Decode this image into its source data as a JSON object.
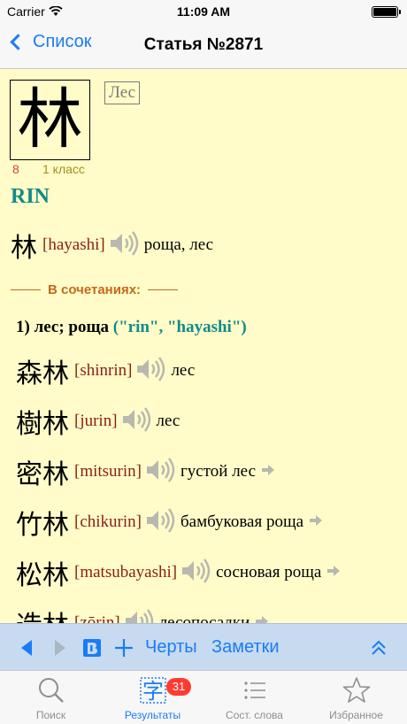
{
  "status_bar": {
    "carrier": "Carrier",
    "time": "11:09 AM"
  },
  "nav": {
    "back_label": "Список",
    "title": "Статья №2871"
  },
  "kanji": {
    "character": "林",
    "meaning": "Лес",
    "strokes": "8",
    "grade": "1 класс",
    "on_reading": "RIN"
  },
  "main_entry": {
    "jp": "林",
    "romaji": "[hayashi]",
    "translation": "роща, лес"
  },
  "combinations": {
    "header": "В сочетаниях:",
    "sense": "1) лес; роща",
    "sense_readings": "(\"rin\", \"hayashi\")",
    "items": [
      {
        "jp": "森林",
        "romaji": "[shinrin]",
        "translation": "лес"
      },
      {
        "jp": "樹林",
        "romaji": "[jurin]",
        "translation": "лес"
      },
      {
        "jp": "密林",
        "romaji": "[mitsurin]",
        "translation": "густой лес"
      },
      {
        "jp": "竹林",
        "romaji": "[chikurin]",
        "translation": "бамбуковая роща"
      },
      {
        "jp": "松林",
        "romaji": "[matsubayashi]",
        "translation": "сосновая роща"
      },
      {
        "jp": "造林",
        "romaji": "[zōrin]",
        "translation": "лесопосадки"
      }
    ]
  },
  "toolbar": {
    "strokes_label": "Черты",
    "notes_label": "Заметки"
  },
  "tabs": [
    {
      "label": "Поиск"
    },
    {
      "label": "Результаты",
      "badge": "31",
      "icon_char": "字"
    },
    {
      "label": "Сост. слова"
    },
    {
      "label": "Избранное"
    }
  ],
  "colors": {
    "accent": "#1a7cf5",
    "background": "#fffcc9",
    "reading": "#138a8a",
    "romaji": "#8b1e14",
    "header": "#c46a1d",
    "badge": "#ff3b30"
  }
}
